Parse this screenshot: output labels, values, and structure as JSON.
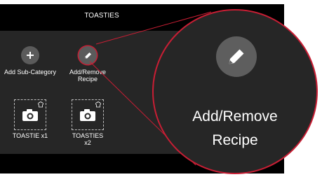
{
  "header": {
    "title": "TOASTIES"
  },
  "actions": {
    "add_sub_category": {
      "label": "Add Sub-Category",
      "icon": "plus-icon"
    },
    "add_remove_recipe": {
      "label_line1": "Add/Remove",
      "label_line2": "Recipe",
      "icon": "pencil-icon"
    }
  },
  "items": [
    {
      "label": "TOASTIE x1",
      "icon": "camera-icon"
    },
    {
      "label_line1": "TOASTIES",
      "label_line2": "x2",
      "icon": "camera-icon"
    }
  ],
  "callout": {
    "line1": "Add/Remove",
    "line2": "Recipe",
    "icon": "pencil-icon"
  },
  "colors": {
    "highlight": "#c81e34",
    "panel": "#262626",
    "header": "#000000",
    "icon_circle": "#5b5b5b",
    "text": "#ffffff"
  }
}
